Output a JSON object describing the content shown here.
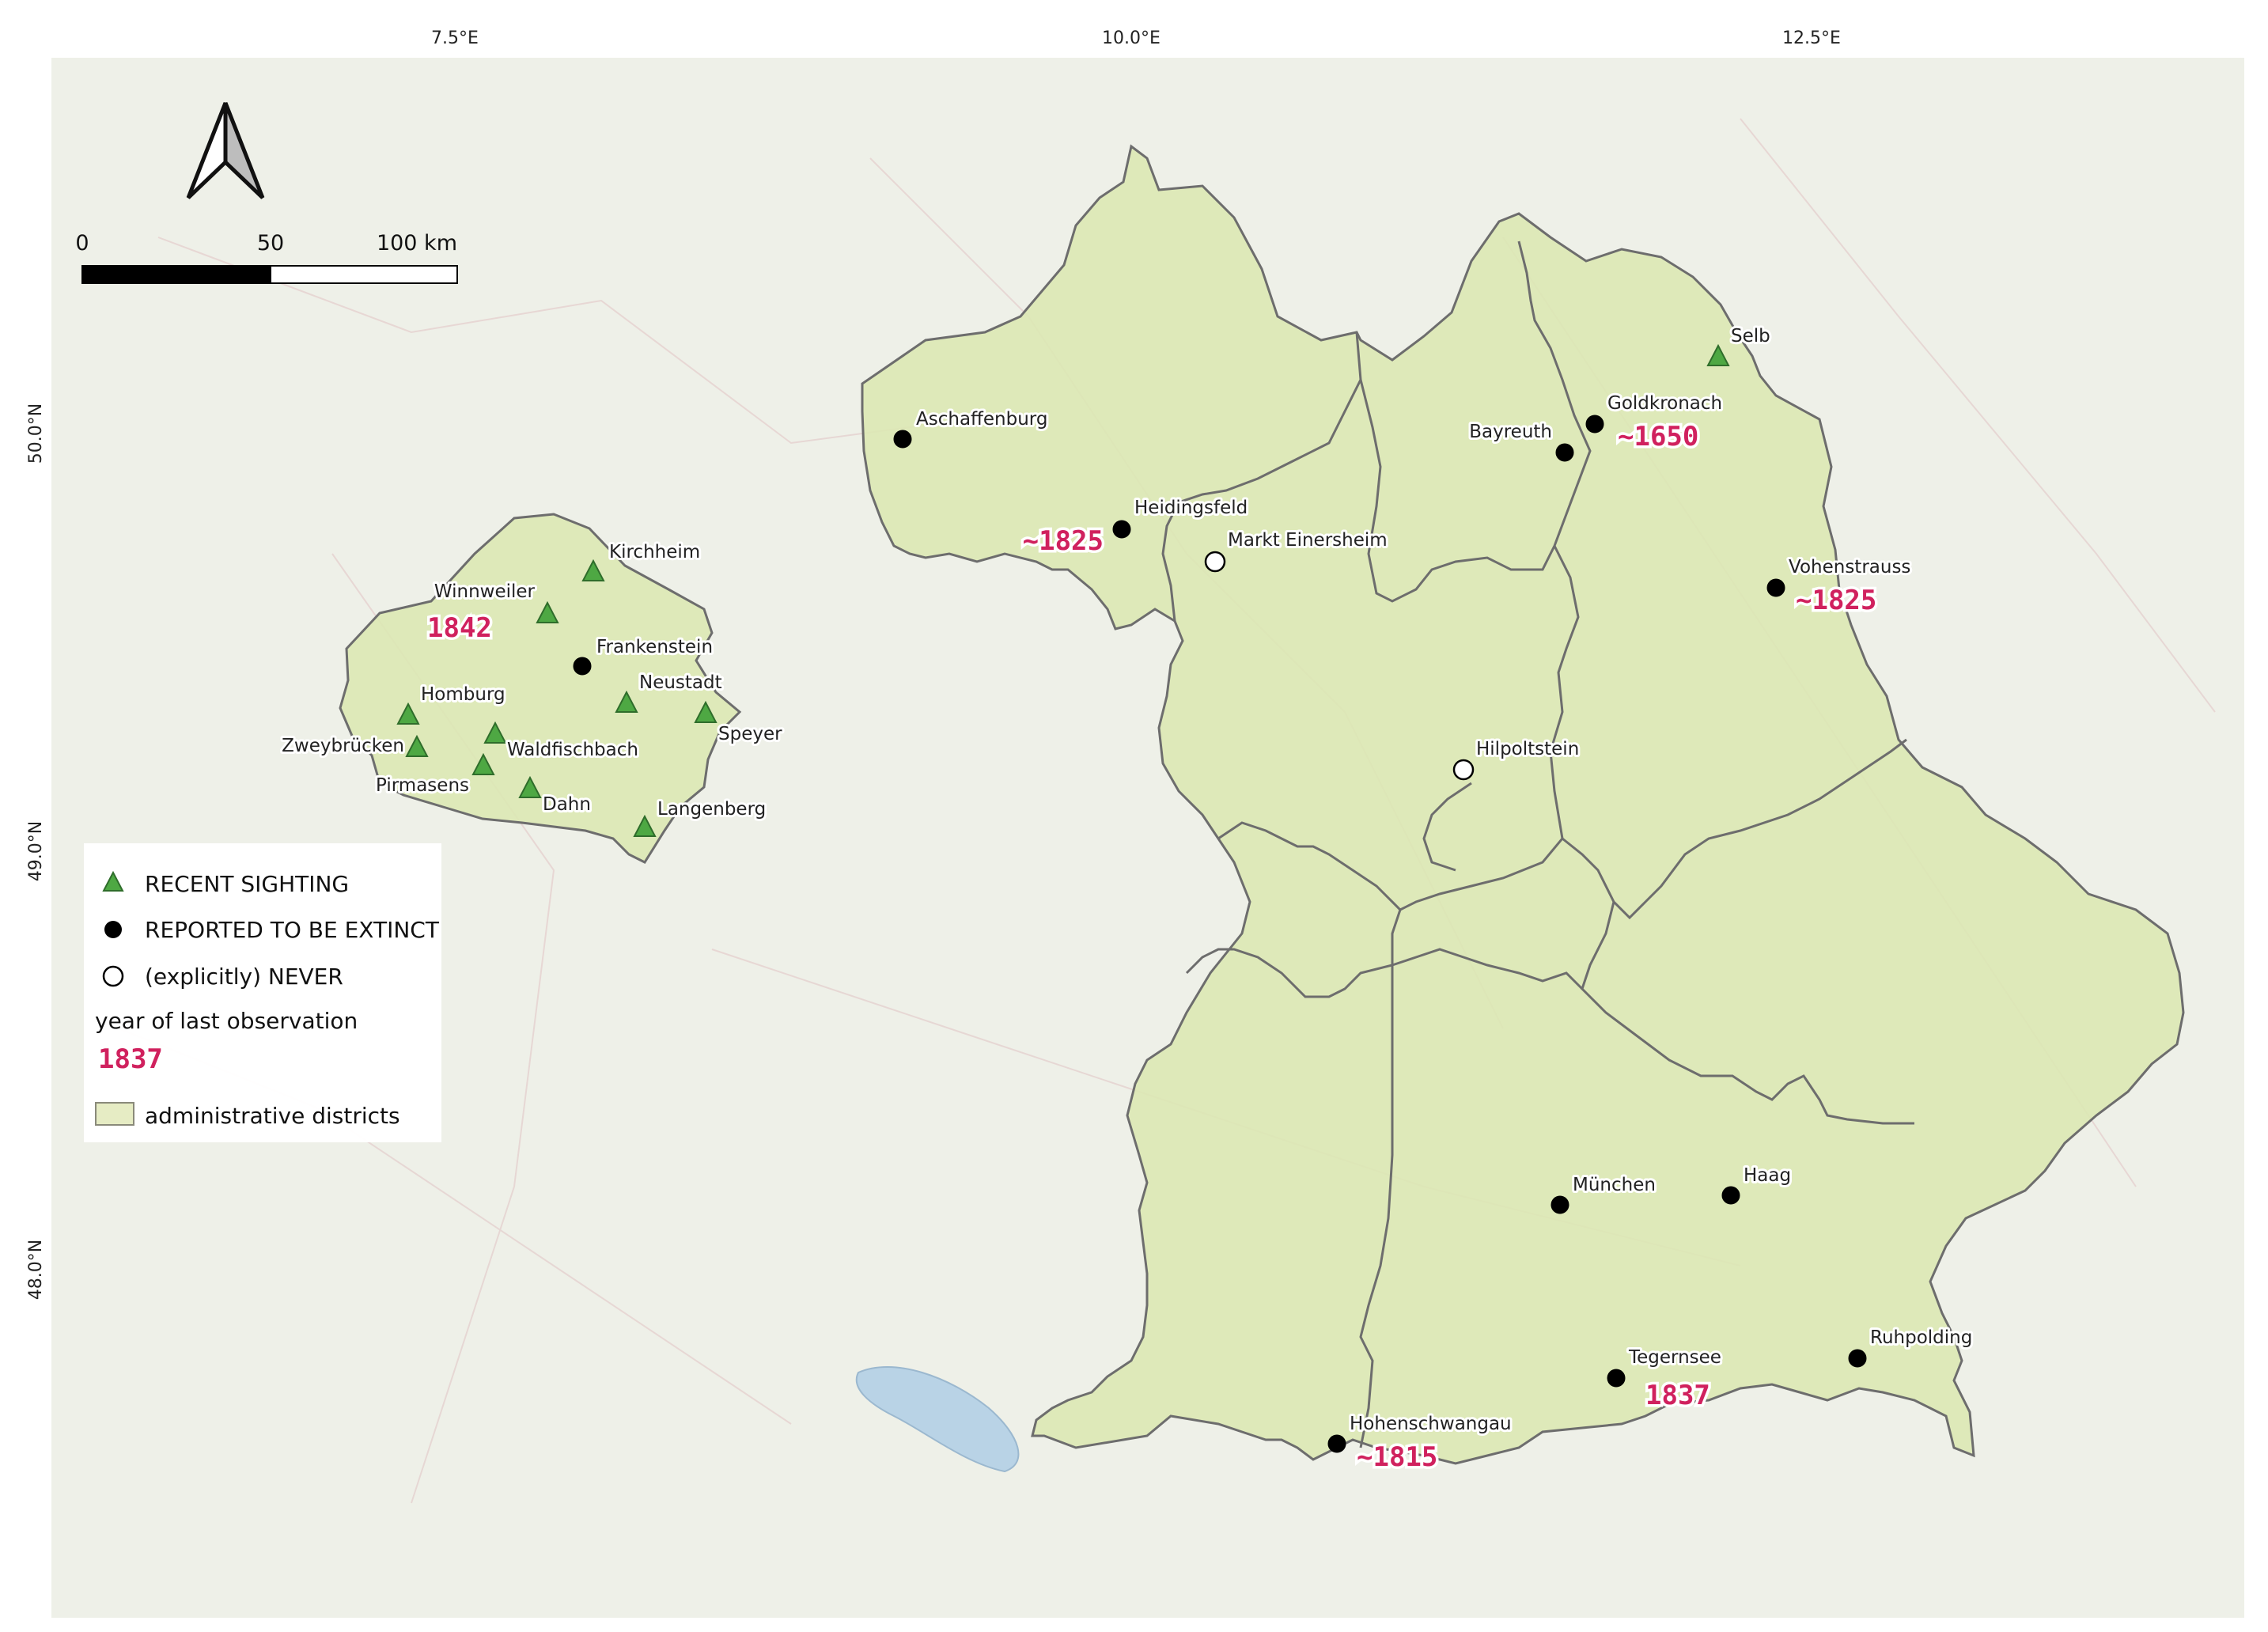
{
  "axes": {
    "lon_ticks": [
      "7.5°E",
      "10.0°E",
      "12.5°E"
    ],
    "lat_ticks": [
      "50.0°N",
      "49.0°N",
      "48.0°N"
    ]
  },
  "scale_bar": {
    "labels": [
      "0",
      "50",
      "100 km"
    ]
  },
  "legend": {
    "recent": "RECENT SIGHTING",
    "extinct": "REPORTED TO BE EXTINCT",
    "never": "(explicitly) NEVER",
    "year_caption": "year of last observation",
    "year_example": "1837",
    "districts": "administrative districts"
  },
  "colors": {
    "district_fill": "#dce8b4",
    "district_stroke": "#6d6d6d",
    "recent_marker": "#4ea843",
    "extinct_marker": "#000000",
    "year_text": "#d0215e",
    "land": "#eef0e8",
    "lake": "#b9d3e6"
  },
  "places": [
    {
      "name": "Kirchheim",
      "status": "recent"
    },
    {
      "name": "Winnweiler",
      "status": "recent",
      "year": "1842"
    },
    {
      "name": "Frankenstein",
      "status": "extinct"
    },
    {
      "name": "Neustadt",
      "status": "recent"
    },
    {
      "name": "Homburg",
      "status": "recent"
    },
    {
      "name": "Speyer",
      "status": "recent"
    },
    {
      "name": "Zweybrücken",
      "status": "recent"
    },
    {
      "name": "Waldfischbach",
      "status": "recent"
    },
    {
      "name": "Pirmasens",
      "status": "recent"
    },
    {
      "name": "Dahn",
      "status": "recent"
    },
    {
      "name": "Langenberg",
      "status": "recent"
    },
    {
      "name": "Aschaffenburg",
      "status": "extinct"
    },
    {
      "name": "Heidingsfeld",
      "status": "extinct",
      "year": "~1825"
    },
    {
      "name": "Markt Einersheim",
      "status": "never"
    },
    {
      "name": "Selb",
      "status": "recent"
    },
    {
      "name": "Goldkronach",
      "status": "extinct",
      "year": "~1650"
    },
    {
      "name": "Bayreuth",
      "status": "extinct"
    },
    {
      "name": "Vohenstrauss",
      "status": "extinct",
      "year": "~1825"
    },
    {
      "name": "Hilpoltstein",
      "status": "never"
    },
    {
      "name": "München",
      "status": "extinct"
    },
    {
      "name": "Haag",
      "status": "extinct"
    },
    {
      "name": "Ruhpolding",
      "status": "extinct"
    },
    {
      "name": "Tegernsee",
      "status": "extinct",
      "year": "1837"
    },
    {
      "name": "Hohenschwangau",
      "status": "extinct",
      "year": "~1815"
    }
  ]
}
